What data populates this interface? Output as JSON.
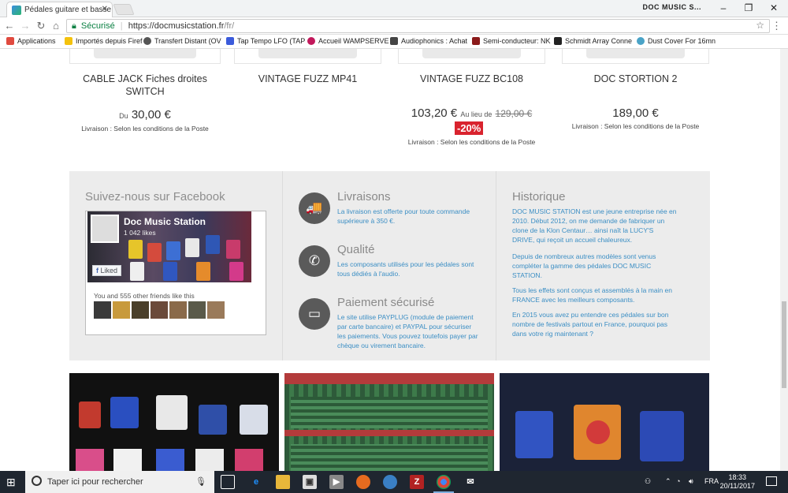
{
  "browser": {
    "tab_title": "Pédales guitare et basse",
    "window_title": "DOC MUSIC S...",
    "secure_label": "Sécurisé",
    "url_host": "https://docmusicstation.fr",
    "url_path": "/fr/",
    "bookmarks": [
      {
        "label": "Applications",
        "color": "#e04a3f"
      },
      {
        "label": "Importés depuis Firef",
        "color": "#f4c20d"
      },
      {
        "label": "Transfert Distant (OV",
        "color": "#555555"
      },
      {
        "label": "Tap Tempo LFO (TAP",
        "color": "#3b5bdb"
      },
      {
        "label": "Accueil WAMPSERVE",
        "color": "#c2185b"
      },
      {
        "label": "Audiophonics : Achat",
        "color": "#444444"
      },
      {
        "label": "Semi-conducteur: NK",
        "color": "#8b1a1a"
      },
      {
        "label": "Schmidt Array Conne",
        "color": "#222222"
      },
      {
        "label": "Dust Cover For 16mn",
        "color": "#4aa3c7"
      }
    ]
  },
  "products": [
    {
      "title_line1": "CABLE JACK Fiches droites",
      "title_line2": "SWITCH",
      "prefix": "Du",
      "price": "30,00 €",
      "delivery": "Livraison : Selon les conditions de la Poste"
    },
    {
      "title_line1": "VINTAGE FUZZ MP41",
      "title_line2": "",
      "prefix": "",
      "price": "",
      "delivery": ""
    },
    {
      "title_line1": "VINTAGE FUZZ BC108",
      "title_line2": "",
      "prefix": "",
      "price": "103,20 €",
      "instead_of": "Au lieu de",
      "old_price": "129,00 €",
      "discount": "-20%",
      "delivery": "Livraison : Selon les conditions de la Poste"
    },
    {
      "title_line1": "DOC STORTION 2",
      "title_line2": "",
      "prefix": "",
      "price": "189,00 €",
      "delivery": "Livraison : Selon les conditions de la Poste"
    }
  ],
  "facebook": {
    "heading": "Suivez-nous sur Facebook",
    "page_name": "Doc Music Station",
    "likes": "1 042 likes",
    "liked_label": "Liked",
    "friends_text": "You and 555 other friends like this"
  },
  "services": [
    {
      "title": "Livraisons",
      "icon": "truck-icon",
      "glyph": "🚚",
      "lines": [
        "La livraison est offerte pour toute commande",
        "supérieure à 350 €."
      ]
    },
    {
      "title": "Qualité",
      "icon": "phone-icon",
      "glyph": "✆",
      "lines": [
        "Les composants utilisés pour les pédales sont",
        "tous dédiés à l'audio."
      ]
    },
    {
      "title": "Paiement sécurisé",
      "icon": "credit-card-icon",
      "glyph": "▭",
      "lines": [
        "Le site utilise PAYPLUG (module de paiement",
        "par carte bancaire) et PAYPAL pour sécuriser",
        "les paiements. Vous pouvez toutefois payer par",
        "chèque ou virement bancaire."
      ]
    }
  ],
  "history": {
    "title": "Historique",
    "paragraphs": [
      [
        "DOC MUSIC STATION est une jeune entreprise née en",
        "2010.  Début 2012, on me demande de fabriquer un",
        "clone de la Klon Centaur… ainsi naît la LUCY'S",
        "DRIVE, qui reçoit un accueil chaleureux."
      ],
      [
        "Depuis de nombreux autres modèles sont venus",
        "compléter la gamme des pédales DOC MUSIC",
        "STATION."
      ],
      [
        "Tous les effets sont conçus et assemblés à la main en",
        "FRANCE avec les meilleurs composants."
      ],
      [
        "En 2015 vous avez pu entendre ces pédales sur bon",
        "nombre de festivals partout en France, pourquoi pas",
        "dans votre rig maintenant ?"
      ]
    ]
  },
  "taskbar": {
    "search_placeholder": "Taper ici pour rechercher",
    "language": "FRA",
    "time": "18:33",
    "date": "20/11/2017"
  }
}
